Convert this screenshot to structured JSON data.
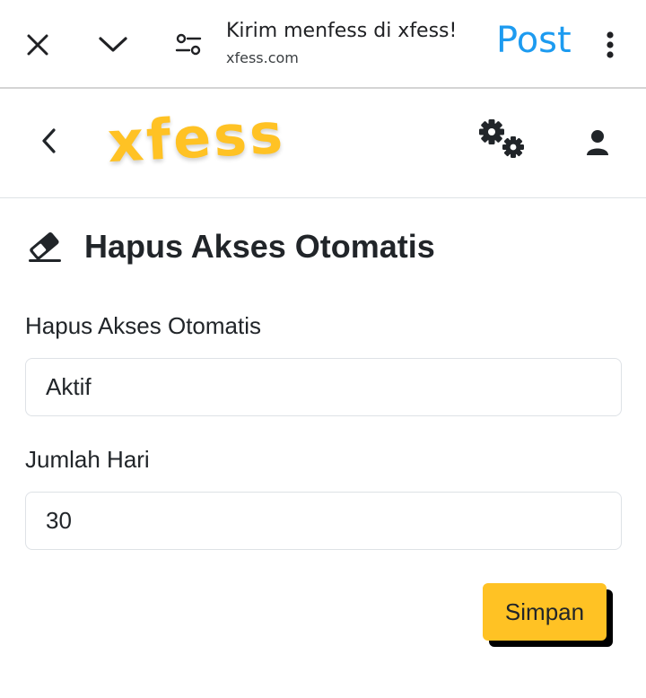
{
  "browser": {
    "page_title": "Kirim menfess di xfess!",
    "url": "xfess.com",
    "post_label": "Post",
    "icons": {
      "close": "close-icon",
      "chevron": "chevron-down-icon",
      "settings": "tune-icon",
      "more": "more-vert-icon"
    }
  },
  "nav": {
    "brand": "xfess",
    "icons": {
      "back": "chevron-left-icon",
      "settings": "gears-icon",
      "user": "user-icon"
    }
  },
  "main": {
    "heading_icon": "eraser-icon",
    "heading": "Hapus Akses Otomatis",
    "fields": [
      {
        "label": "Hapus Akses Otomatis",
        "value": "Aktif"
      },
      {
        "label": "Jumlah Hari",
        "value": "30"
      }
    ],
    "save_label": "Simpan"
  },
  "colors": {
    "brand_yellow": "#ffc224",
    "post_blue": "#1d9bf0",
    "text_dark": "#212529",
    "border_gray": "#dee2e6"
  }
}
